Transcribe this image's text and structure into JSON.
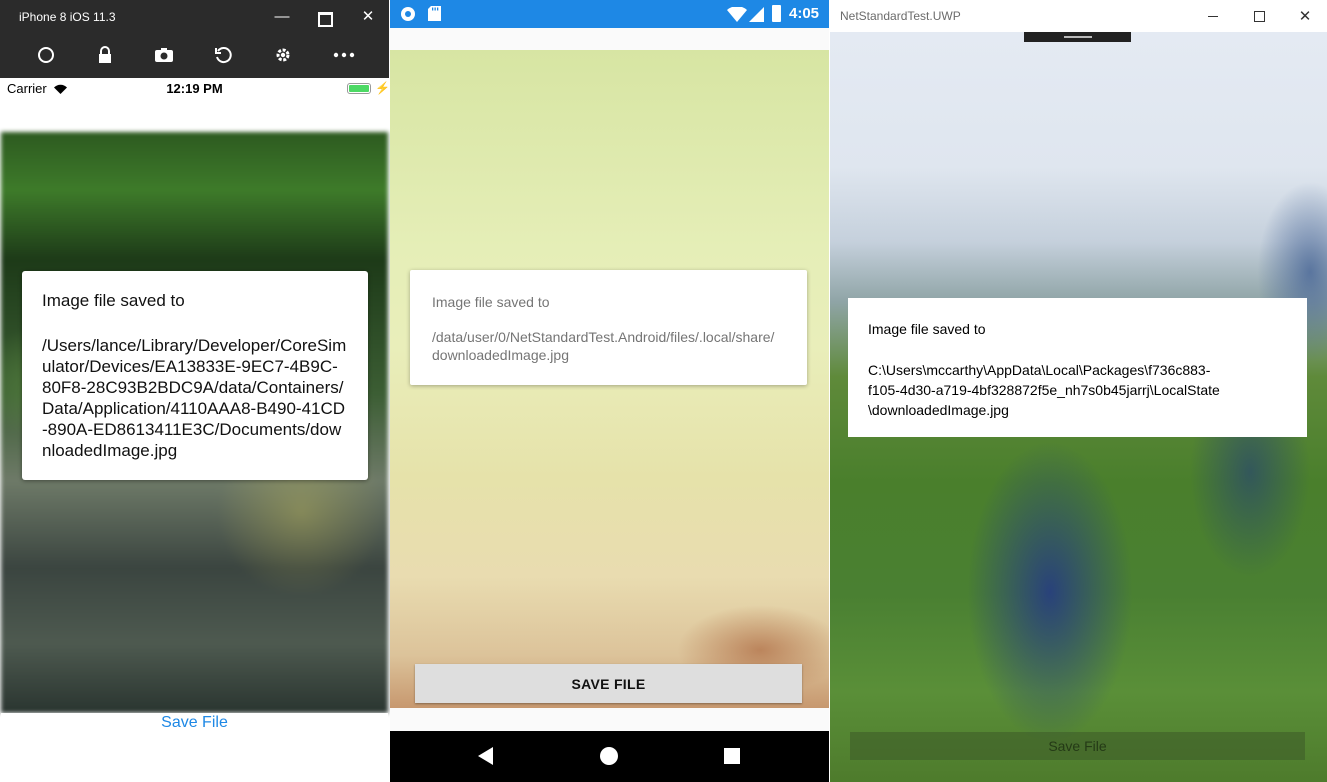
{
  "ios": {
    "window_title": "iPhone 8 iOS 11.3",
    "status": {
      "carrier": "Carrier",
      "time": "12:19 PM"
    },
    "dialog": {
      "title": "Image file saved to",
      "message": "/Users/lance/Library/Developer/CoreSimulator/Devices/EA13833E-9EC7-4B9C-80F8-28C93B2BDC9A/data/Containers/Data/Application/4110AAA8-B490-41CD-890A-ED8613411E3C/Documents/downloadedImage.jpg"
    },
    "save_button": "Save File"
  },
  "android": {
    "status": {
      "time": "4:05"
    },
    "dialog": {
      "title": "Image file saved to",
      "message": "/data/user/0/NetStandardTest.Android/files/.local/share/downloadedImage.jpg"
    },
    "save_button": "SAVE FILE"
  },
  "uwp": {
    "window_title": "NetStandardTest.UWP",
    "dialog": {
      "title": "Image file saved to",
      "message_line1": "C:\\Users\\mccarthy\\AppData\\Local\\Packages\\f736c883-",
      "message_line2": "f105-4d30-a719-4bf328872f5e_nh7s0b45jarrj\\LocalState",
      "message_line3": "\\downloadedImage.jpg"
    },
    "save_button": "Save File"
  }
}
